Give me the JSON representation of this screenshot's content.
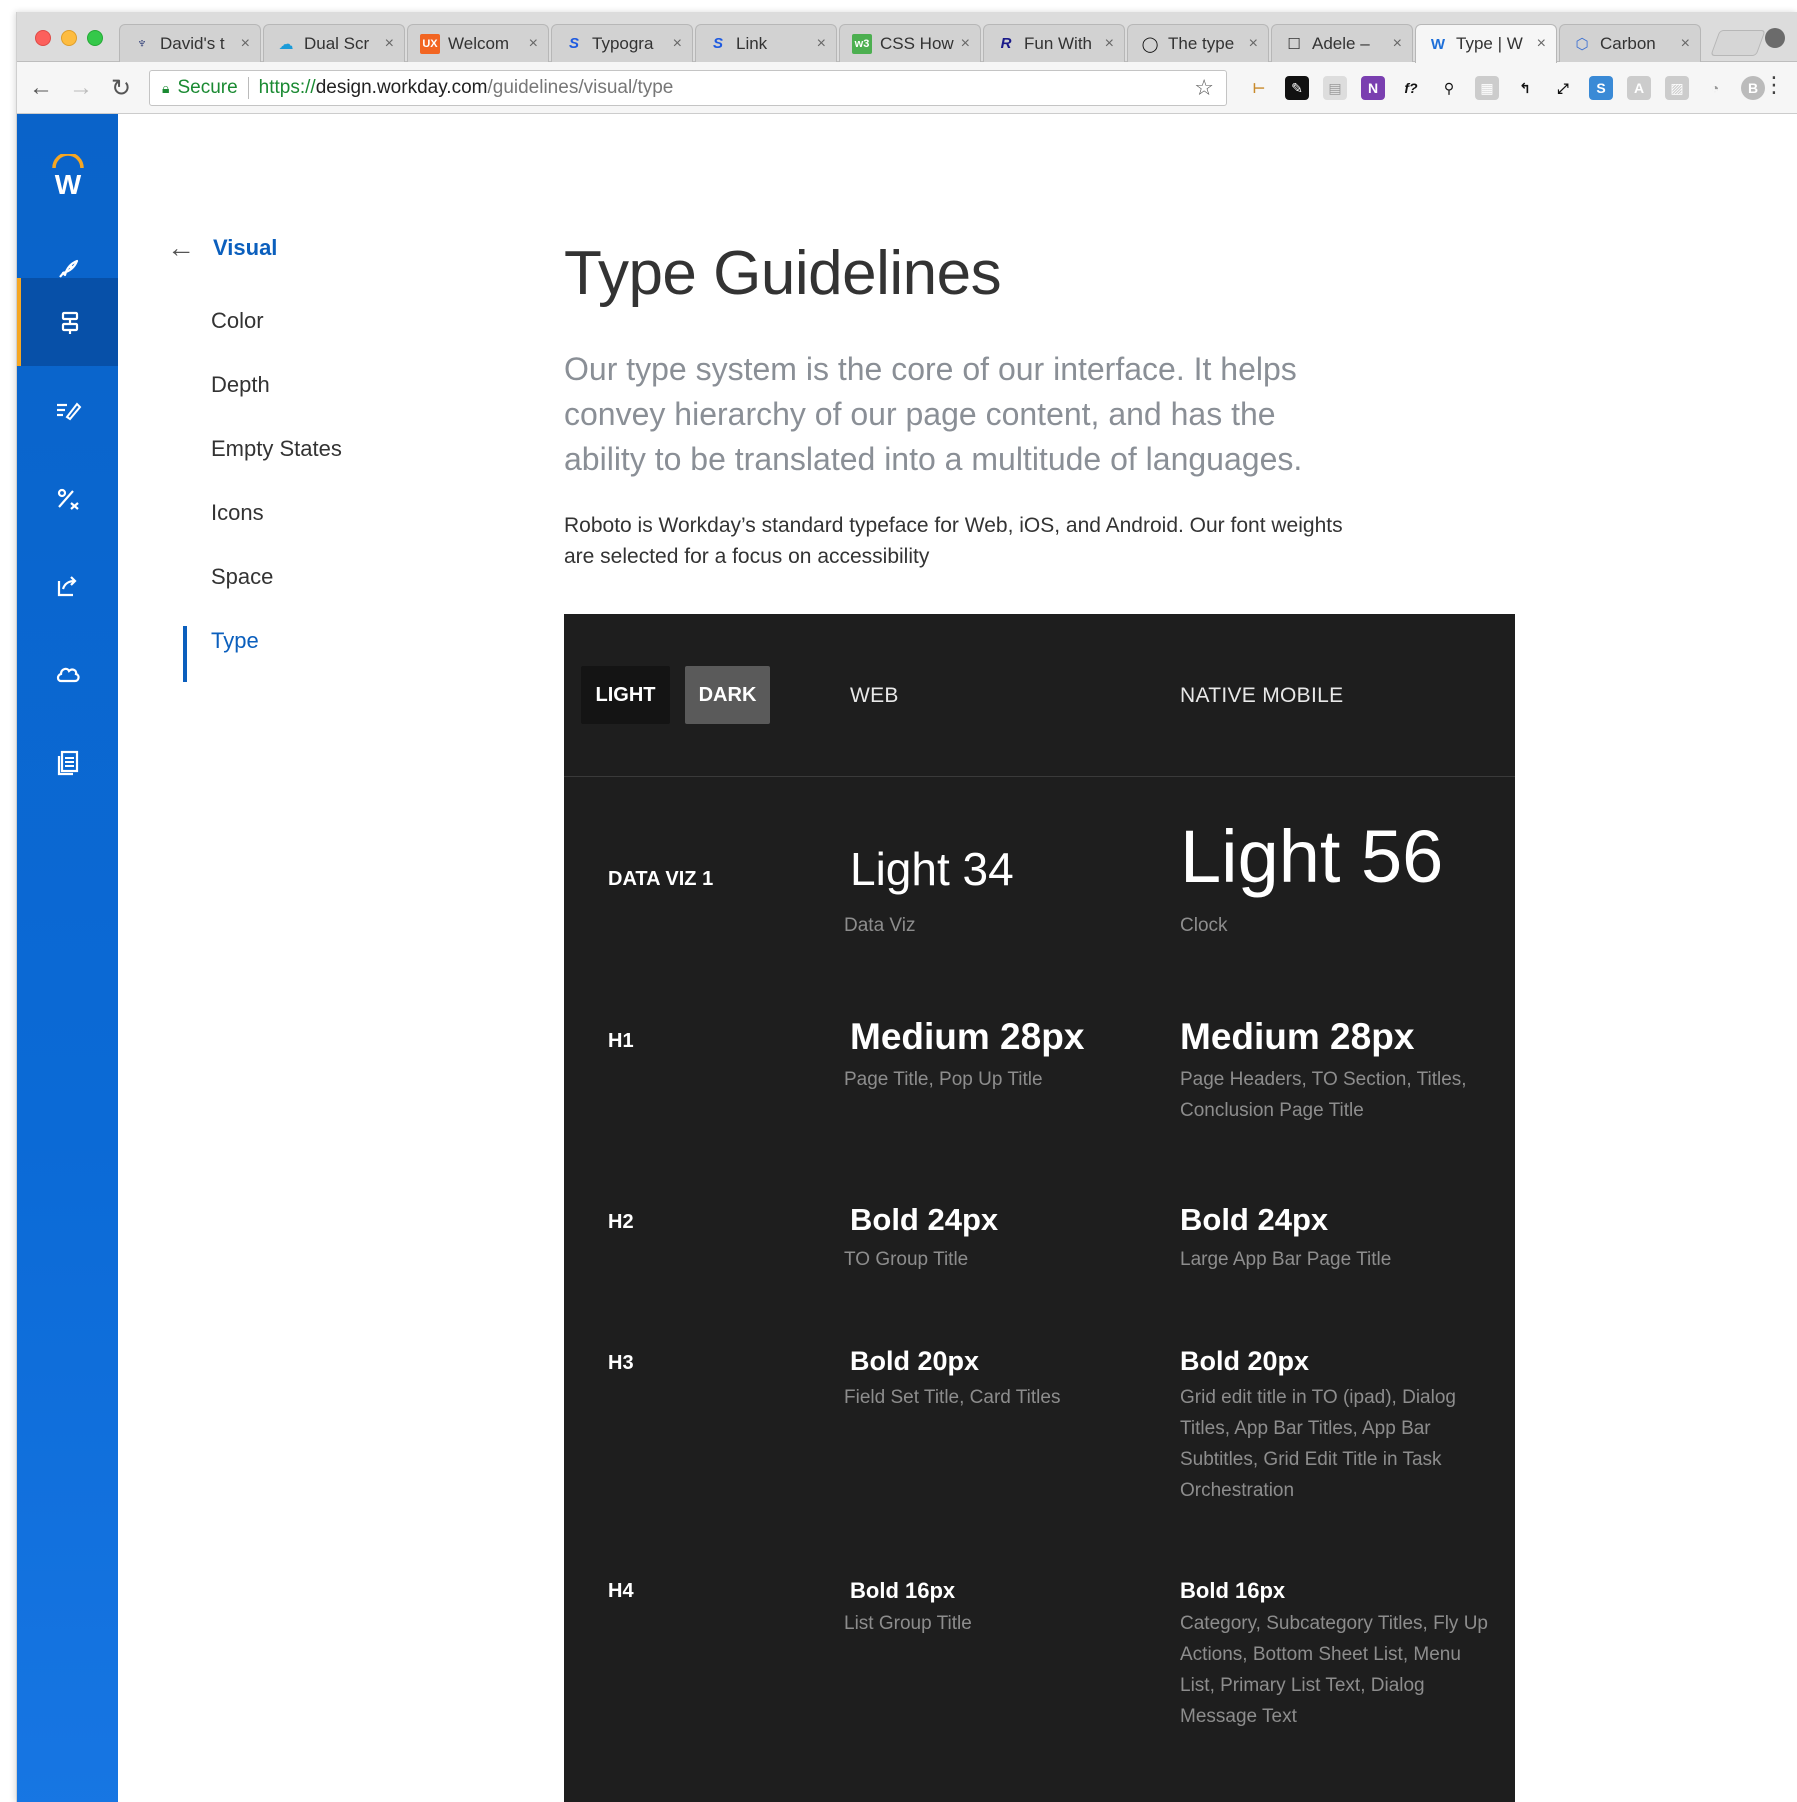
{
  "browser": {
    "tabs": [
      {
        "title": "David's t",
        "icon_color": "#1a2a6b",
        "glyph": "♆"
      },
      {
        "title": "Dual Scr",
        "icon_color": "#1b9bd8",
        "glyph": "☁"
      },
      {
        "title": "Welcom",
        "icon_color": "#f26522",
        "glyph": "UX"
      },
      {
        "title": "Typogra",
        "icon_color": "#1e5ae0",
        "glyph": "S"
      },
      {
        "title": "Link",
        "icon_color": "#1e5ae0",
        "glyph": "S"
      },
      {
        "title": "CSS How",
        "icon_color": "#4caf50",
        "glyph": "w3"
      },
      {
        "title": "Fun With",
        "icon_color": "#1a1a8a",
        "glyph": "R"
      },
      {
        "title": "The type",
        "icon_color": "#111111",
        "glyph": "◯"
      },
      {
        "title": "Adele –",
        "icon_color": "#333333",
        "glyph": "☐"
      },
      {
        "title": "Type | W",
        "icon_color": "#1e6fd9",
        "glyph": "W"
      },
      {
        "title": "Carbon",
        "icon_color": "#3b6fd1",
        "glyph": "⬡"
      }
    ],
    "secure_label": "Secure",
    "url_scheme": "https://",
    "url_host": "design.workday.com",
    "url_path": "/guidelines/visual/type"
  },
  "sidebar": {
    "back_label": "Visual",
    "items": [
      "Color",
      "Depth",
      "Empty States",
      "Icons",
      "Space",
      "Type"
    ],
    "active_item": "Type"
  },
  "main": {
    "title": "Type Guidelines",
    "intro": "Our type system is the core of our interface. It helps convey hierarchy of our page content, and has the ability to be translated into a multitude of languages.",
    "body": "Roboto is Workday’s standard typeface for Web, iOS, and Android. Our font weights are selected for a focus on accessibility"
  },
  "type_table": {
    "toggle_light": "LIGHT",
    "toggle_dark": "DARK",
    "active_theme": "DARK",
    "col_web": "WEB",
    "col_mobile": "NATIVE MOBILE",
    "rows": [
      {
        "label": "DATA VIZ 1",
        "web_spec": "Light 34",
        "web_desc": "Data Viz",
        "mobile_spec": "Light 56",
        "mobile_desc": "Clock"
      },
      {
        "label": "H1",
        "web_spec": "Medium 28px",
        "web_desc": "Page Title, Pop Up Title",
        "mobile_spec": "Medium 28px",
        "mobile_desc": "Page Headers, TO Section, Titles, Conclusion Page Title"
      },
      {
        "label": "H2",
        "web_spec": "Bold 24px",
        "web_desc": "TO Group Title",
        "mobile_spec": "Bold 24px",
        "mobile_desc": "Large App Bar Page Title"
      },
      {
        "label": "H3",
        "web_spec": "Bold 20px",
        "web_desc": "Field Set Title, Card Titles",
        "mobile_spec": "Bold 20px",
        "mobile_desc": "Grid edit title in TO (ipad), Dialog Titles, App Bar Titles, App Bar Subtitles, Grid Edit Title in Task Orchestration"
      },
      {
        "label": "H4",
        "web_spec": "Bold 16px",
        "web_desc": "List Group Title",
        "mobile_spec": "Bold 16px",
        "mobile_desc": "Category, Subcategory Titles, Fly Up Actions, Bottom Sheet List, Menu List, Primary List Text, Dialog Message Text"
      }
    ]
  },
  "colors": {
    "rail_blue": "#0b6ad6",
    "accent_orange": "#f5a623",
    "link_blue": "#0b5fbd",
    "panel_bg": "#1e1e1e"
  }
}
